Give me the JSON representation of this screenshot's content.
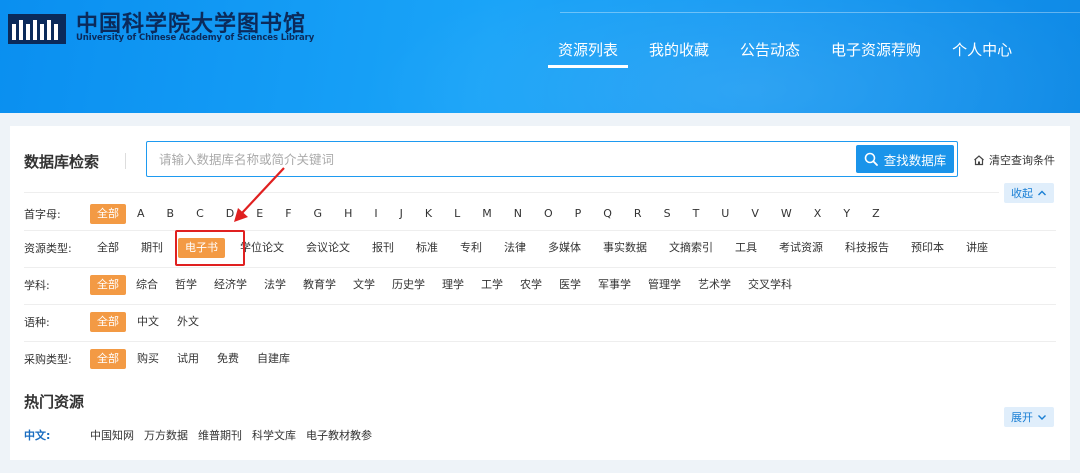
{
  "header": {
    "logo_cn": "中国科学院大学图书馆",
    "logo_en": "University of Chinese Academy of Sciences Library",
    "nav": [
      "资源列表",
      "我的收藏",
      "公告动态",
      "电子资源荐购",
      "个人中心"
    ],
    "active_nav": "资源列表"
  },
  "search": {
    "title": "数据库检索",
    "placeholder": "请输入数据库名称或简介关键词",
    "value": "",
    "button_label": "查找数据库",
    "clear_label": "清空查询条件",
    "collapse_label": "收起"
  },
  "filters": [
    {
      "label": "首字母:",
      "selected": "全部",
      "options": [
        "全部",
        "A",
        "B",
        "C",
        "D",
        "E",
        "F",
        "G",
        "H",
        "I",
        "J",
        "K",
        "L",
        "M",
        "N",
        "O",
        "P",
        "Q",
        "R",
        "S",
        "T",
        "U",
        "V",
        "W",
        "X",
        "Y",
        "Z"
      ]
    },
    {
      "label": "资源类型:",
      "selected": "电子书",
      "options": [
        "全部",
        "期刊",
        "电子书",
        "学位论文",
        "会议论文",
        "报刊",
        "标准",
        "专利",
        "法律",
        "多媒体",
        "事实数据",
        "文摘索引",
        "工具",
        "考试资源",
        "科技报告",
        "预印本",
        "讲座"
      ]
    },
    {
      "label": "学科:",
      "selected": "全部",
      "options": [
        "全部",
        "综合",
        "哲学",
        "经济学",
        "法学",
        "教育学",
        "文学",
        "历史学",
        "理学",
        "工学",
        "农学",
        "医学",
        "军事学",
        "管理学",
        "艺术学",
        "交叉学科"
      ]
    },
    {
      "label": "语种:",
      "selected": "全部",
      "options": [
        "全部",
        "中文",
        "外文"
      ]
    },
    {
      "label": "采购类型:",
      "selected": "全部",
      "options": [
        "全部",
        "购买",
        "试用",
        "免费",
        "自建库"
      ]
    }
  ],
  "hot": {
    "title": "热门资源",
    "label": "中文:",
    "items": [
      "中国知网",
      "万方数据",
      "维普期刊",
      "科学文库",
      "电子教材教参"
    ],
    "expand_label": "展开"
  },
  "colors": {
    "header_blue": "#1aa4f8",
    "accent_orange": "#f39a44",
    "button_blue": "#1a94ea",
    "annotation_red": "#e02020"
  }
}
